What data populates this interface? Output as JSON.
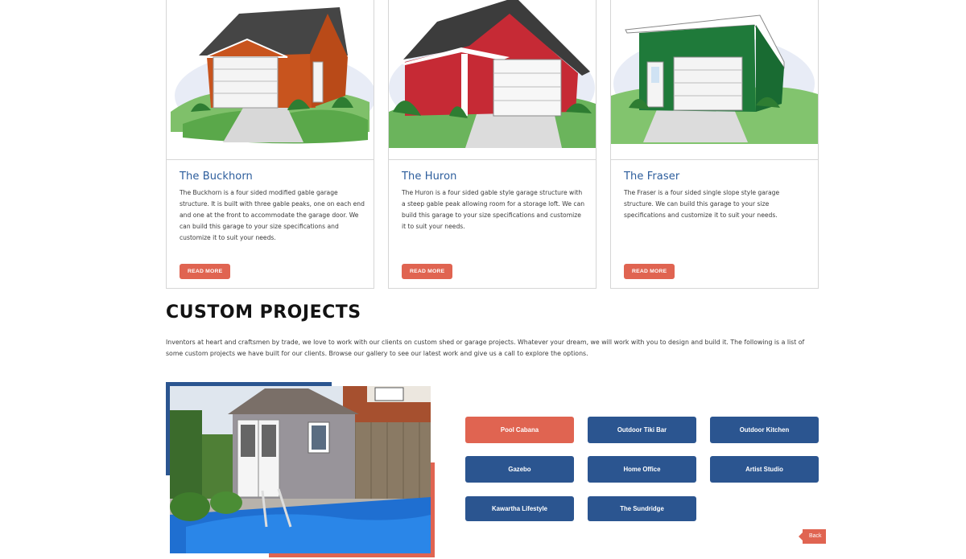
{
  "garages": [
    {
      "title": "The Buckhorn",
      "description": "The Buckhorn is a four sided modified gable garage structure. It is built with three gable peaks, one on each end and one at the front to accommodate the garage door. We can build this garage to your size specifications and customize it to suit your needs.",
      "button": "READ MORE",
      "image_icon": "buckhorn-garage-illustration"
    },
    {
      "title": "The Huron",
      "description": "The Huron is a four sided gable style garage structure with a steep gable peak allowing room for a storage loft. We can build this garage to your size specifications and customize it to suit your needs.",
      "button": "READ MORE",
      "image_icon": "huron-garage-illustration"
    },
    {
      "title": "The Fraser",
      "description": "The Fraser is a four sided single slope style garage structure. We can build this garage to your size specifications and customize it to suit your needs.",
      "button": "READ MORE",
      "image_icon": "fraser-garage-illustration"
    }
  ],
  "custom": {
    "heading": "CUSTOM PROJECTS",
    "intro": "Inventors at heart and craftsmen by trade, we love to work with our clients on custom shed or garage projects. Whatever your dream, we will work with you to design and build it. The following is a list of some custom projects we have built for our clients. Browse our gallery to see our latest work and give us a call to explore the options.",
    "photo_icon": "pool-cabana-photo",
    "projects": [
      "Pool Cabana",
      "Outdoor Tiki Bar",
      "Outdoor Kitchen",
      "Gazebo",
      "Home Office",
      "Artist Studio",
      "Kawartha Lifestyle",
      "The Sundridge"
    ],
    "active_project": "Pool Cabana"
  },
  "back_label": "Back",
  "colors": {
    "primary_blue": "#2b5590",
    "accent_red": "#e06451",
    "title_blue": "#2c5d9c"
  }
}
